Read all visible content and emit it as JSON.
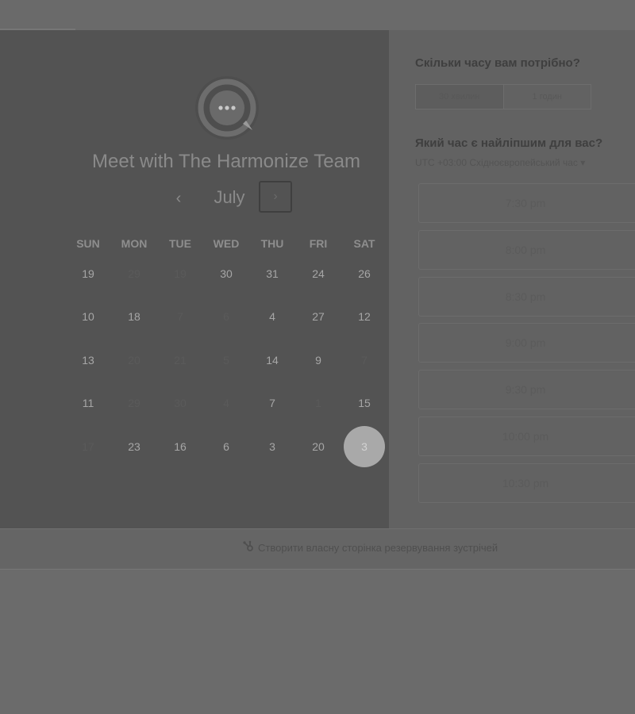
{
  "meeting": {
    "title": "Meet with The Harmonize Team"
  },
  "calendar": {
    "month": "July",
    "prev_icon": "chevron-left-icon",
    "next_icon": "chevron-right-icon",
    "weekdays": [
      "SUN",
      "MON",
      "TUE",
      "WED",
      "THU",
      "FRI",
      "SAT"
    ],
    "weeks": [
      [
        {
          "d": "19",
          "a": true
        },
        {
          "d": "29",
          "a": false
        },
        {
          "d": "19",
          "a": false
        },
        {
          "d": "30",
          "a": true
        },
        {
          "d": "31",
          "a": true
        },
        {
          "d": "24",
          "a": true
        },
        {
          "d": "26",
          "a": true
        }
      ],
      [
        {
          "d": "10",
          "a": true
        },
        {
          "d": "18",
          "a": true
        },
        {
          "d": "7",
          "a": false
        },
        {
          "d": "6",
          "a": false
        },
        {
          "d": "4",
          "a": true
        },
        {
          "d": "27",
          "a": true
        },
        {
          "d": "12",
          "a": true
        }
      ],
      [
        {
          "d": "13",
          "a": true
        },
        {
          "d": "20",
          "a": false
        },
        {
          "d": "21",
          "a": false
        },
        {
          "d": "5",
          "a": false
        },
        {
          "d": "14",
          "a": true
        },
        {
          "d": "9",
          "a": true
        },
        {
          "d": "7",
          "a": false
        }
      ],
      [
        {
          "d": "11",
          "a": true
        },
        {
          "d": "29",
          "a": false
        },
        {
          "d": "30",
          "a": false
        },
        {
          "d": "4",
          "a": false
        },
        {
          "d": "7",
          "a": true
        },
        {
          "d": "1",
          "a": false
        },
        {
          "d": "15",
          "a": true
        }
      ],
      [
        {
          "d": "17",
          "a": false
        },
        {
          "d": "23",
          "a": true
        },
        {
          "d": "16",
          "a": true
        },
        {
          "d": "6",
          "a": true
        },
        {
          "d": "3",
          "a": true
        },
        {
          "d": "20",
          "a": true
        },
        {
          "d": "3",
          "a": true,
          "selected": true
        }
      ]
    ]
  },
  "duration": {
    "heading": "Скільки часу вам потрібно?",
    "options": [
      "30 хвилин",
      "1 годин"
    ],
    "selected": "30 хвилин"
  },
  "times": {
    "heading": "Який час є найліпшим для вас?",
    "timezone": "UTC +03:00 Східноєвропейський час",
    "slots": [
      "7:30 pm",
      "8:00 pm",
      "8:30 pm",
      "9:00 pm",
      "9:30 pm",
      "10:00 pm",
      "10:30 pm"
    ]
  },
  "footer": {
    "link_label": "Створити власну сторінка резервування зустрічей",
    "icon": "hubspot-sprocket-icon"
  },
  "colors": {
    "overlay": "#6b6b6b",
    "selected_day": "#a9a9a9"
  }
}
